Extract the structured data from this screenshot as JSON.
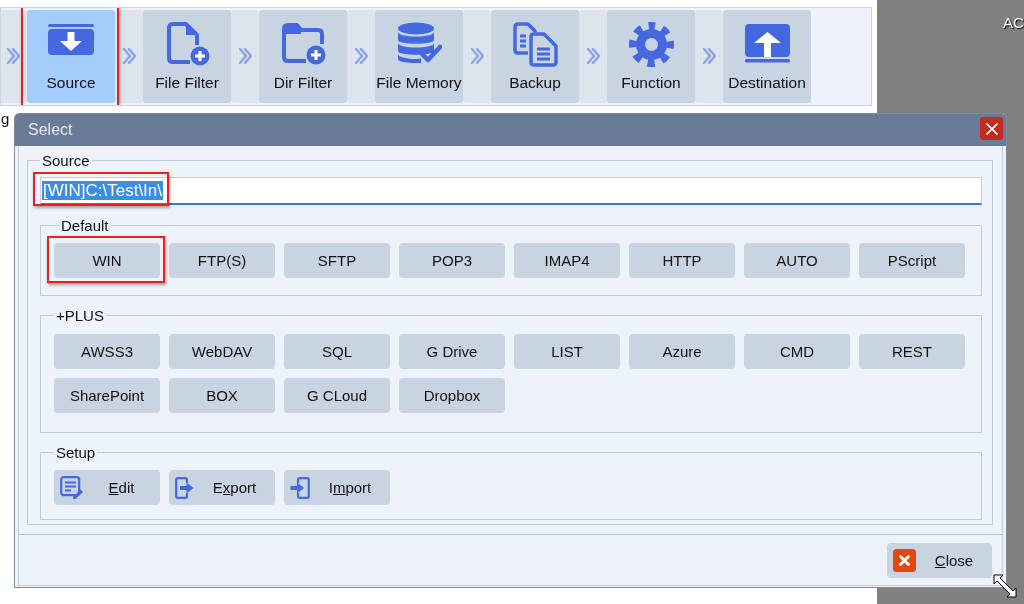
{
  "toolbar": {
    "items": [
      {
        "label": "Source",
        "kind": "download",
        "selected": true,
        "highlighted": true
      },
      {
        "label": "File Filter",
        "kind": "file-add",
        "selected": false,
        "highlighted": false
      },
      {
        "label": "Dir Filter",
        "kind": "folder-add",
        "selected": false,
        "highlighted": false
      },
      {
        "label": "File Memory",
        "kind": "database",
        "selected": false,
        "highlighted": false
      },
      {
        "label": "Backup",
        "kind": "copies",
        "selected": false,
        "highlighted": false
      },
      {
        "label": "Function",
        "kind": "gear",
        "selected": false,
        "highlighted": false
      },
      {
        "label": "Destination",
        "kind": "upload",
        "selected": false,
        "highlighted": false
      }
    ]
  },
  "cut_label": "g",
  "desktop": {
    "label": "AC"
  },
  "dialog": {
    "title": "Select",
    "source": {
      "legend": "Source",
      "field": {
        "value": "[WIN]C:\\Test\\In\\",
        "focused": true,
        "text_selected": true,
        "highlighted": true
      },
      "protocol_groups": [
        {
          "legend": "Default",
          "buttons": [
            {
              "label": "WIN",
              "highlighted": true
            },
            {
              "label": "FTP(S)",
              "highlighted": false
            },
            {
              "label": "SFTP",
              "highlighted": false
            },
            {
              "label": "POP3",
              "highlighted": false
            },
            {
              "label": "IMAP4",
              "highlighted": false
            },
            {
              "label": "HTTP",
              "highlighted": false
            },
            {
              "label": "AUTO",
              "highlighted": false
            },
            {
              "label": "PScript",
              "highlighted": false
            }
          ]
        },
        {
          "legend": "+PLUS",
          "buttons": [
            {
              "label": "AWSS3",
              "highlighted": false
            },
            {
              "label": "WebDAV",
              "highlighted": false
            },
            {
              "label": "SQL",
              "highlighted": false
            },
            {
              "label": "G Drive",
              "highlighted": false
            },
            {
              "label": "LIST",
              "highlighted": false
            },
            {
              "label": "Azure",
              "highlighted": false
            },
            {
              "label": "CMD",
              "highlighted": false
            },
            {
              "label": "REST",
              "highlighted": false
            },
            {
              "label": "SharePoint",
              "highlighted": false
            },
            {
              "label": "BOX",
              "highlighted": false
            },
            {
              "label": "G CLoud",
              "highlighted": false
            },
            {
              "label": "Dropbox",
              "highlighted": false
            }
          ]
        }
      ],
      "setup": {
        "legend": "Setup",
        "buttons": [
          {
            "kind": "edit",
            "label": {
              "underlined": "E",
              "after": "dit"
            }
          },
          {
            "kind": "export",
            "label": {
              "before": "E",
              "underlined": "x",
              "after": "port"
            }
          },
          {
            "kind": "import",
            "label": {
              "before": "I",
              "underlined": "m",
              "after": "port"
            }
          }
        ]
      }
    },
    "close_button": {
      "label": {
        "underlined": "C",
        "after": "lose"
      }
    }
  }
}
